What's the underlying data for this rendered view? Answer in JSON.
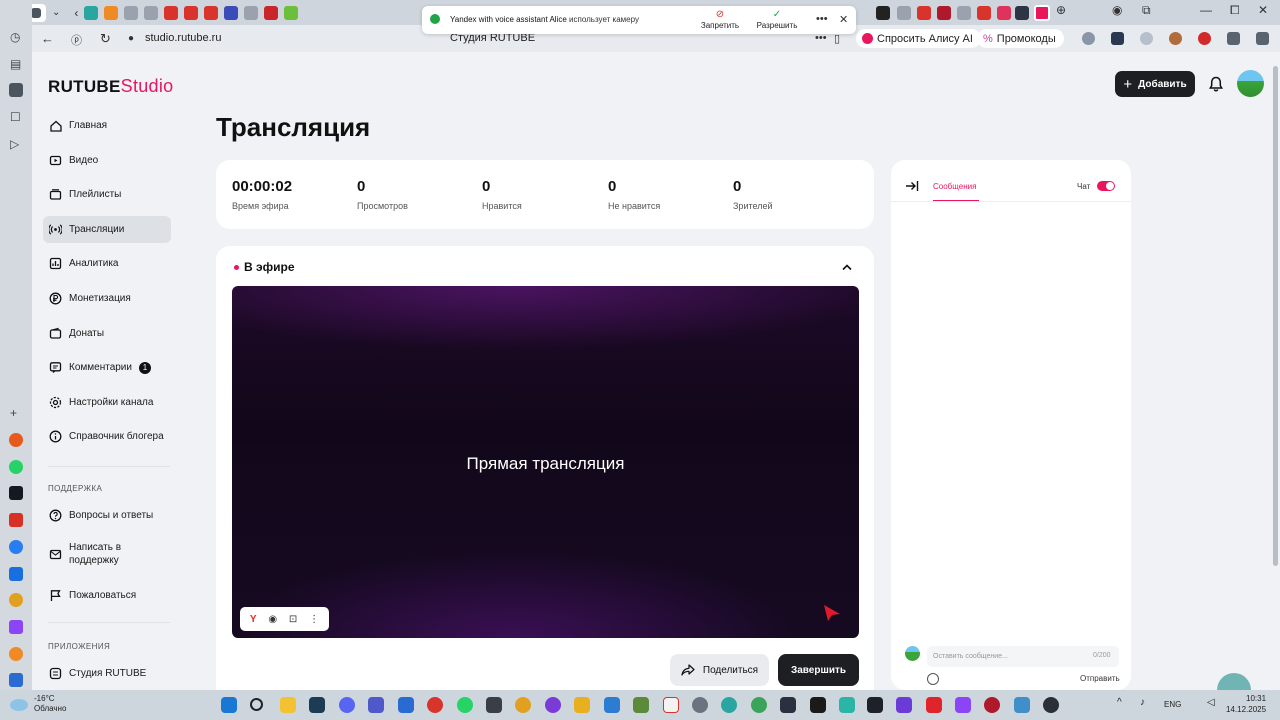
{
  "permission": {
    "message_app": "Yandex with voice assistant Alice",
    "message_rest": "использует камеру",
    "deny_label": "Запретить",
    "allow_label": "Разрешить"
  },
  "address_bar": {
    "url": "studio.rutube.ru",
    "page_title": "Студия RUTUBE",
    "alice_label": "Спросить Алису AI",
    "promo_label": "Промокоды"
  },
  "brand": {
    "main": "RUTUBE",
    "sub": "Studio"
  },
  "header": {
    "add_label": "Добавить"
  },
  "sidebar": {
    "items": [
      {
        "label": "Главная",
        "icon": "home-icon"
      },
      {
        "label": "Видео",
        "icon": "video-icon"
      },
      {
        "label": "Плейлисты",
        "icon": "playlist-icon"
      },
      {
        "label": "Трансляции",
        "icon": "broadcast-icon"
      },
      {
        "label": "Аналитика",
        "icon": "analytics-icon"
      },
      {
        "label": "Монетизация",
        "icon": "ruble-icon"
      },
      {
        "label": "Донаты",
        "icon": "wallet-icon"
      },
      {
        "label": "Комментарии",
        "icon": "comment-icon",
        "badge": "1"
      },
      {
        "label": "Настройки канала",
        "icon": "gear-icon"
      },
      {
        "label": "Справочник блогера",
        "icon": "info-icon"
      }
    ],
    "support_title": "ПОДДЕРЖКА",
    "support_items": [
      {
        "label": "Вопросы и ответы",
        "icon": "question-icon"
      },
      {
        "label": "Написать в поддержку",
        "icon": "mail-icon"
      },
      {
        "label": "Пожаловаться",
        "icon": "flag-icon"
      }
    ],
    "apps_title": "ПРИЛОЖЕНИЯ",
    "apps_items": [
      {
        "label": "Студия RUTUBE",
        "icon": "app-icon"
      }
    ]
  },
  "main": {
    "title": "Трансляция",
    "stats": [
      {
        "value": "00:00:02",
        "label": "Время эфира"
      },
      {
        "value": "0",
        "label": "Просмотров"
      },
      {
        "value": "0",
        "label": "Нравится"
      },
      {
        "value": "0",
        "label": "Не нравится"
      },
      {
        "value": "0",
        "label": "Зрителей"
      }
    ],
    "live_label": "В эфире",
    "player_text": "Прямая трансляция",
    "share_label": "Поделиться",
    "end_label": "Завершить"
  },
  "chat": {
    "tab_label": "Сообщения",
    "toggle_label": "Чат",
    "toggle_on": true,
    "input_placeholder": "Оставить сообщение...",
    "counter": "0/200",
    "send_label": "Отправить"
  },
  "taskbar": {
    "temperature": "-16°C",
    "weather": "Облачно",
    "language": "ENG",
    "time": "10:31",
    "date": "14.12.2025"
  },
  "colors": {
    "accent": "#e8175d",
    "dark_button": "#1e1f22"
  }
}
